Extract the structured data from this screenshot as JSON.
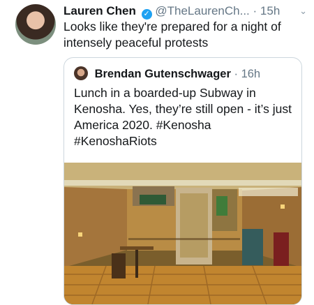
{
  "tweet": {
    "author_name": "Lauren Chen",
    "handle": "@TheLaurenCh...",
    "separator": "·",
    "time": "15h",
    "text": "Looks like they're prepared for a night of intensely peaceful protests"
  },
  "quoted": {
    "author_name": "Brendan Gutenschwager",
    "separator": "·",
    "time": "16h",
    "text": "Lunch in a boarded-up Subway in Kenosha. Yes, they’re still open - it’s just America 2020. #Kenosha #KenoshaRiots"
  },
  "icons": {
    "verified": "verified-check-icon",
    "menu": "chevron-down-icon"
  },
  "colors": {
    "verified_blue": "#1da1f2",
    "muted_text": "#657786",
    "card_border": "#ccd6dd"
  }
}
